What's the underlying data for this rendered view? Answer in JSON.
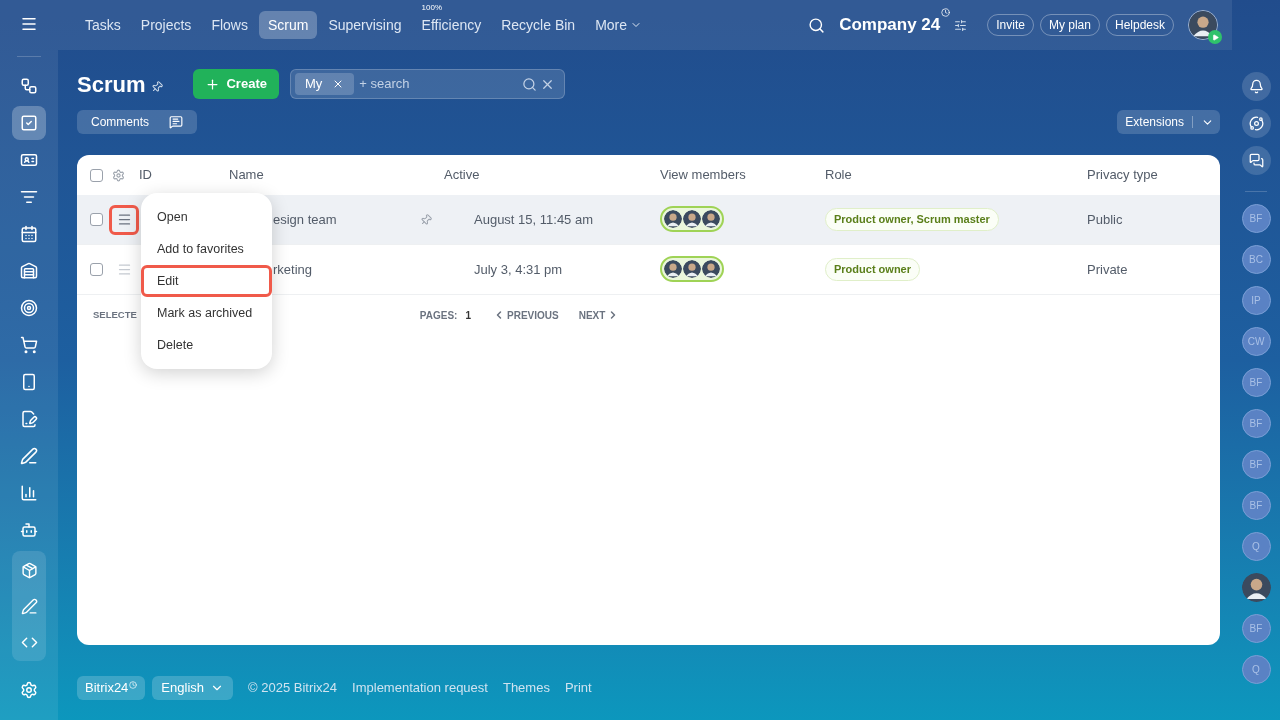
{
  "top_nav": {
    "items": [
      {
        "label": "Tasks",
        "selected": false
      },
      {
        "label": "Projects",
        "selected": false
      },
      {
        "label": "Flows",
        "selected": false
      },
      {
        "label": "Scrum",
        "selected": true
      },
      {
        "label": "Supervising",
        "selected": false
      },
      {
        "label": "Efficiency",
        "selected": false,
        "badge": "100%"
      },
      {
        "label": "Recycle Bin",
        "selected": false
      },
      {
        "label": "More",
        "selected": false,
        "dropdown": true
      }
    ],
    "company": "Company 24",
    "buttons": [
      "Invite",
      "My plan",
      "Helpdesk"
    ]
  },
  "left_sidebar": {
    "items": [
      {
        "selected": false
      },
      {
        "selected": true
      },
      {
        "selected": false
      },
      {
        "selected": false
      },
      {
        "selected": false
      },
      {
        "selected": false
      },
      {
        "selected": false
      },
      {
        "selected": false
      },
      {
        "selected": false
      },
      {
        "selected": false
      },
      {
        "selected": false
      },
      {
        "selected": false
      },
      {
        "selected": false
      }
    ],
    "group_items": [
      {
        "selected": false
      },
      {
        "selected": false
      },
      {
        "selected": false
      }
    ]
  },
  "page": {
    "title": "Scrum",
    "create_button": "Create",
    "filter": {
      "tag": "My",
      "placeholder": "+ search"
    },
    "comments_button": "Comments",
    "extensions_button": "Extensions"
  },
  "table": {
    "all_checked": false,
    "columns": [
      "ID",
      "Name",
      "Active",
      "View members",
      "Role",
      "Privacy type"
    ],
    "rows": [
      {
        "checked": false,
        "name": "esign team",
        "pinned": true,
        "active": "August 15, 11:45 am",
        "role": "Product owner, Scrum master",
        "privacy": "Public",
        "hovered": true,
        "menu_highlighted": true
      },
      {
        "checked": false,
        "name": "rketing",
        "pinned": false,
        "active": "July 3, 4:31 pm",
        "role": "Product owner",
        "privacy": "Private",
        "hovered": false,
        "menu_highlighted": false
      }
    ],
    "footer": {
      "selected": "SELECTE",
      "pages_label": "PAGES:",
      "page": "1",
      "previous": "PREVIOUS",
      "next": "NEXT"
    }
  },
  "context_menu": {
    "items": [
      {
        "label": "Open",
        "highlighted": false
      },
      {
        "label": "Add to favorites",
        "highlighted": false
      },
      {
        "label": "Edit",
        "highlighted": true
      },
      {
        "label": "Mark as archived",
        "highlighted": false
      },
      {
        "label": "Delete",
        "highlighted": false
      }
    ]
  },
  "right_sidebar": {
    "contacts": [
      {
        "kind": "initials",
        "initials": "BF"
      },
      {
        "kind": "initials",
        "initials": "BC"
      },
      {
        "kind": "initials",
        "initials": "IP"
      },
      {
        "kind": "initials",
        "initials": "CW"
      },
      {
        "kind": "initials",
        "initials": "BF"
      },
      {
        "kind": "initials",
        "initials": "BF"
      },
      {
        "kind": "initials",
        "initials": "BF"
      },
      {
        "kind": "initials",
        "initials": "BF"
      },
      {
        "kind": "initials",
        "initials": "Q"
      },
      {
        "kind": "photo"
      },
      {
        "kind": "initials",
        "initials": "BF"
      },
      {
        "kind": "initials",
        "initials": "Q"
      }
    ]
  },
  "footer": {
    "brand": "Bitrix24",
    "language": "English",
    "links": [
      "© 2025 Bitrix24",
      "Implementation request",
      "Themes",
      "Print"
    ]
  }
}
